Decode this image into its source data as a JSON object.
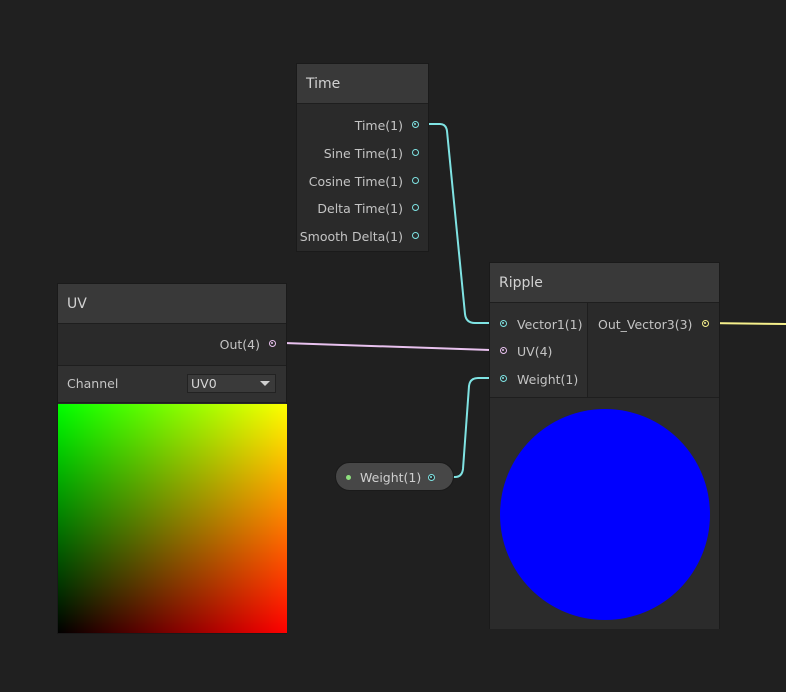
{
  "colors": {
    "background": "#202020",
    "vector1_port": "#7fe3e3",
    "vector4_port": "#e9c2ef",
    "vector3_port": "#f6f08c",
    "property_dot": "#8ee07e",
    "ripple_preview": "#0000ff"
  },
  "time_node": {
    "title": "Time",
    "outputs": [
      "Time(1)",
      "Sine Time(1)",
      "Cosine Time(1)",
      "Delta Time(1)",
      "Smooth Delta(1)"
    ]
  },
  "uv_node": {
    "title": "UV",
    "output": "Out(4)",
    "channel_label": "Channel",
    "channel_value": "UV0"
  },
  "ripple_node": {
    "title": "Ripple",
    "inputs": [
      "Vector1(1)",
      "UV(4)",
      "Weight(1)"
    ],
    "output": "Out_Vector3(3)"
  },
  "weight_property": {
    "label": "Weight(1)"
  }
}
